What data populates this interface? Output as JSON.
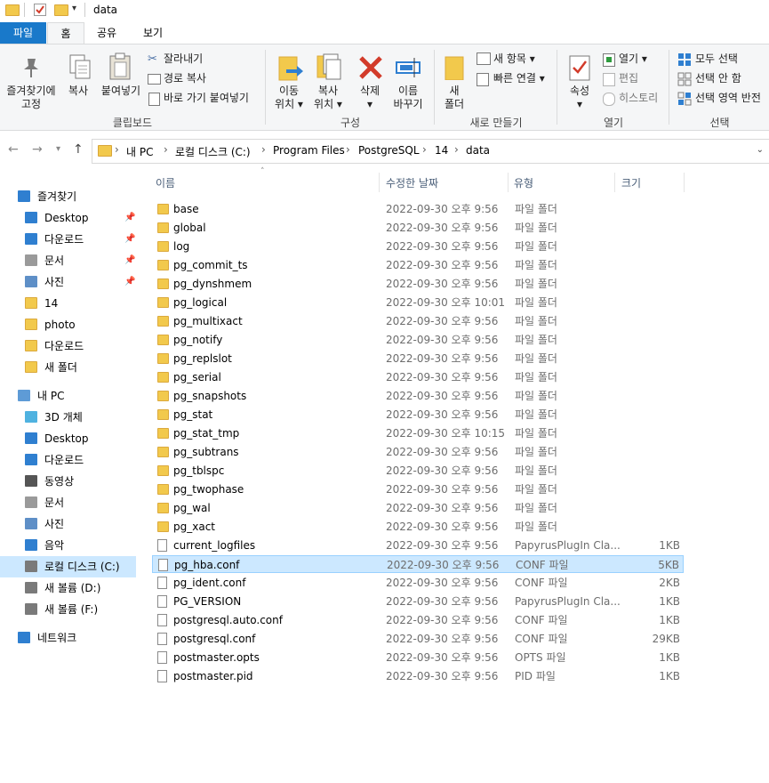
{
  "titlebar": {
    "title": "data"
  },
  "tabs": {
    "file": "파일",
    "home": "홈",
    "share": "공유",
    "view": "보기"
  },
  "ribbon": {
    "clipboard": {
      "pin": [
        "즐겨찾기에",
        "고정"
      ],
      "copy": "복사",
      "paste": "붙여넣기",
      "cut": "잘라내기",
      "copy_path": "경로 복사",
      "paste_shortcut": "바로 가기 붙여넣기",
      "label": "클립보드"
    },
    "organize": {
      "move": [
        "이동",
        "위치 ▾"
      ],
      "copy": [
        "복사",
        "위치 ▾"
      ],
      "delete": [
        "삭제",
        "▾"
      ],
      "rename": [
        "이름",
        "바꾸기"
      ],
      "label": "구성"
    },
    "new": {
      "folder": [
        "새",
        "폴더"
      ],
      "new_item": "새 항목 ▾",
      "easy_access": "빠른 연결 ▾",
      "label": "새로 만들기"
    },
    "open": {
      "properties": [
        "속성",
        "▾"
      ],
      "open": "열기 ▾",
      "edit": "편집",
      "history": "히스토리",
      "label": "열기"
    },
    "select": {
      "select_all": "모두 선택",
      "select_none": "선택 안 함",
      "invert": "선택 영역 반전",
      "label": "선택"
    }
  },
  "address": {
    "crumbs": [
      "내 PC",
      "로컬 디스크 (C:)",
      "Program Files",
      "PostgreSQL",
      "14",
      "data"
    ]
  },
  "sidebar": {
    "items": [
      {
        "label": "즐겨찾기",
        "icon": "star-icon",
        "pinned": false
      },
      {
        "label": "Desktop",
        "icon": "desktop-icon",
        "pinned": true
      },
      {
        "label": "다운로드",
        "icon": "download-icon",
        "pinned": true
      },
      {
        "label": "문서",
        "icon": "document-icon",
        "pinned": true
      },
      {
        "label": "사진",
        "icon": "picture-icon",
        "pinned": true
      },
      {
        "label": "14",
        "icon": "folder-icon",
        "pinned": false
      },
      {
        "label": "photo",
        "icon": "folder-icon",
        "pinned": false
      },
      {
        "label": "다운로드",
        "icon": "folder-icon",
        "pinned": false
      },
      {
        "label": "새 폴더",
        "icon": "folder-icon",
        "pinned": false
      },
      {
        "label": "내 PC",
        "icon": "pc-icon",
        "pinned": false
      },
      {
        "label": "3D 개체",
        "icon": "cube-icon",
        "pinned": false
      },
      {
        "label": "Desktop",
        "icon": "desktop-icon",
        "pinned": false
      },
      {
        "label": "다운로드",
        "icon": "download-icon",
        "pinned": false
      },
      {
        "label": "동영상",
        "icon": "video-icon",
        "pinned": false
      },
      {
        "label": "문서",
        "icon": "document-icon",
        "pinned": false
      },
      {
        "label": "사진",
        "icon": "picture-icon",
        "pinned": false
      },
      {
        "label": "음악",
        "icon": "music-icon",
        "pinned": false
      },
      {
        "label": "로컬 디스크 (C:)",
        "icon": "drive-icon",
        "pinned": false,
        "selected": true
      },
      {
        "label": "새 볼륨 (D:)",
        "icon": "drive-icon",
        "pinned": false
      },
      {
        "label": "새 볼륨 (F:)",
        "icon": "drive-icon",
        "pinned": false
      },
      {
        "label": "네트워크",
        "icon": "network-icon",
        "pinned": false
      }
    ]
  },
  "columns": {
    "name": "이름",
    "date": "수정한 날짜",
    "type": "유형",
    "size": "크기"
  },
  "files": [
    {
      "name": "base",
      "date": "2022-09-30 오후 9:56",
      "type": "파일 폴더",
      "size": "",
      "kind": "folder"
    },
    {
      "name": "global",
      "date": "2022-09-30 오후 9:56",
      "type": "파일 폴더",
      "size": "",
      "kind": "folder"
    },
    {
      "name": "log",
      "date": "2022-09-30 오후 9:56",
      "type": "파일 폴더",
      "size": "",
      "kind": "folder"
    },
    {
      "name": "pg_commit_ts",
      "date": "2022-09-30 오후 9:56",
      "type": "파일 폴더",
      "size": "",
      "kind": "folder"
    },
    {
      "name": "pg_dynshmem",
      "date": "2022-09-30 오후 9:56",
      "type": "파일 폴더",
      "size": "",
      "kind": "folder"
    },
    {
      "name": "pg_logical",
      "date": "2022-09-30 오후 10:01",
      "type": "파일 폴더",
      "size": "",
      "kind": "folder"
    },
    {
      "name": "pg_multixact",
      "date": "2022-09-30 오후 9:56",
      "type": "파일 폴더",
      "size": "",
      "kind": "folder"
    },
    {
      "name": "pg_notify",
      "date": "2022-09-30 오후 9:56",
      "type": "파일 폴더",
      "size": "",
      "kind": "folder"
    },
    {
      "name": "pg_replslot",
      "date": "2022-09-30 오후 9:56",
      "type": "파일 폴더",
      "size": "",
      "kind": "folder"
    },
    {
      "name": "pg_serial",
      "date": "2022-09-30 오후 9:56",
      "type": "파일 폴더",
      "size": "",
      "kind": "folder"
    },
    {
      "name": "pg_snapshots",
      "date": "2022-09-30 오후 9:56",
      "type": "파일 폴더",
      "size": "",
      "kind": "folder"
    },
    {
      "name": "pg_stat",
      "date": "2022-09-30 오후 9:56",
      "type": "파일 폴더",
      "size": "",
      "kind": "folder"
    },
    {
      "name": "pg_stat_tmp",
      "date": "2022-09-30 오후 10:15",
      "type": "파일 폴더",
      "size": "",
      "kind": "folder"
    },
    {
      "name": "pg_subtrans",
      "date": "2022-09-30 오후 9:56",
      "type": "파일 폴더",
      "size": "",
      "kind": "folder"
    },
    {
      "name": "pg_tblspc",
      "date": "2022-09-30 오후 9:56",
      "type": "파일 폴더",
      "size": "",
      "kind": "folder"
    },
    {
      "name": "pg_twophase",
      "date": "2022-09-30 오후 9:56",
      "type": "파일 폴더",
      "size": "",
      "kind": "folder"
    },
    {
      "name": "pg_wal",
      "date": "2022-09-30 오후 9:56",
      "type": "파일 폴더",
      "size": "",
      "kind": "folder"
    },
    {
      "name": "pg_xact",
      "date": "2022-09-30 오후 9:56",
      "type": "파일 폴더",
      "size": "",
      "kind": "folder"
    },
    {
      "name": "current_logfiles",
      "date": "2022-09-30 오후 9:56",
      "type": "PapyrusPlugIn Cla...",
      "size": "1KB",
      "kind": "file"
    },
    {
      "name": "pg_hba.conf",
      "date": "2022-09-30 오후 9:56",
      "type": "CONF 파일",
      "size": "5KB",
      "kind": "file",
      "selected": true
    },
    {
      "name": "pg_ident.conf",
      "date": "2022-09-30 오후 9:56",
      "type": "CONF 파일",
      "size": "2KB",
      "kind": "file"
    },
    {
      "name": "PG_VERSION",
      "date": "2022-09-30 오후 9:56",
      "type": "PapyrusPlugIn Cla...",
      "size": "1KB",
      "kind": "file"
    },
    {
      "name": "postgresql.auto.conf",
      "date": "2022-09-30 오후 9:56",
      "type": "CONF 파일",
      "size": "1KB",
      "kind": "file"
    },
    {
      "name": "postgresql.conf",
      "date": "2022-09-30 오후 9:56",
      "type": "CONF 파일",
      "size": "29KB",
      "kind": "file"
    },
    {
      "name": "postmaster.opts",
      "date": "2022-09-30 오후 9:56",
      "type": "OPTS 파일",
      "size": "1KB",
      "kind": "file"
    },
    {
      "name": "postmaster.pid",
      "date": "2022-09-30 오후 9:56",
      "type": "PID 파일",
      "size": "1KB",
      "kind": "file"
    }
  ],
  "colors": {
    "accent": "#1979ca",
    "selection": "#cce8ff",
    "folder": "#f2c94c"
  }
}
